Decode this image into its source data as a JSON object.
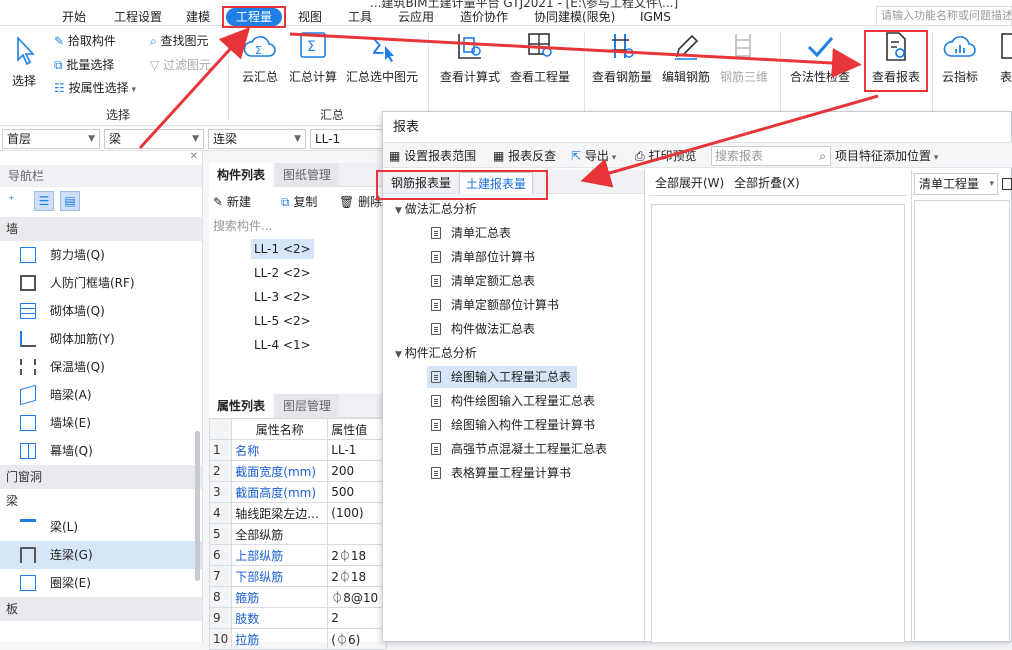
{
  "title_bar": {
    "text": "...建筑BIM土建计量平台 GTJ2021 - [E:\\参与工程文件\\...]"
  },
  "menu": {
    "tabs": [
      "开始",
      "工程设置",
      "建模",
      "工程量",
      "视图",
      "工具",
      "云应用",
      "造价协作",
      "协同建模(限免)",
      "IGMS"
    ],
    "active_tab": "工程量",
    "search_placeholder": "请输入功能名称或问题描述"
  },
  "ribbon": {
    "select_group": {
      "label": "选择",
      "select_btn": "选择",
      "pick": "拾取构件",
      "batch": "批量选择",
      "by_attr": "按属性选择"
    },
    "find_group": {
      "find": "查找图元",
      "filter": "过滤图元"
    },
    "summary_group": {
      "label": "汇总",
      "cloud": "云汇总",
      "calc": "汇总计算",
      "sel_calc": "汇总选中图元"
    },
    "buttons": [
      "查看计算式",
      "查看工程量",
      "查看钢筋量",
      "编辑钢筋",
      "钢筋三维",
      "合法性检查",
      "查看报表",
      "云指标",
      "表"
    ]
  },
  "selectors": {
    "floor": "首层",
    "type": "梁",
    "subtype": "连梁",
    "item": "LL-1"
  },
  "nav": {
    "header": "导航栏",
    "categories": {
      "wall": "墙",
      "door": "门窗洞",
      "beam": "梁",
      "slab": "板"
    },
    "wall_items": [
      "剪力墙(Q)",
      "人防门框墙(RF)",
      "砌体墙(Q)",
      "砌体加筋(Y)",
      "保温墙(Q)",
      "暗梁(A)",
      "墙垛(E)",
      "幕墙(Q)"
    ],
    "beam_items": [
      "梁(L)",
      "连梁(G)",
      "圈梁(E)"
    ],
    "selected_item": "连梁(G)"
  },
  "component_list": {
    "tab_on": "构件列表",
    "tab_off": "图纸管理",
    "new": "新建",
    "copy": "复制",
    "delete": "删除",
    "search_placeholder": "搜索构件...",
    "items": [
      "LL-1 <2>",
      "LL-2 <2>",
      "LL-3 <2>",
      "LL-5 <2>",
      "LL-4 <1>"
    ]
  },
  "props": {
    "tab_on": "属性列表",
    "tab_off": "图层管理",
    "head_name": "属性名称",
    "head_value": "属性值",
    "rows": [
      {
        "n": "1",
        "name": "名称",
        "value": "LL-1"
      },
      {
        "n": "2",
        "name": "截面宽度(mm)",
        "value": "200"
      },
      {
        "n": "3",
        "name": "截面高度(mm)",
        "value": "500"
      },
      {
        "n": "4",
        "name": "轴线距梁左边...",
        "value": "(100)"
      },
      {
        "n": "5",
        "name": "全部纵筋",
        "value": ""
      },
      {
        "n": "6",
        "name": "上部纵筋",
        "value": "2⏀18"
      },
      {
        "n": "7",
        "name": "下部纵筋",
        "value": "2⏀18"
      },
      {
        "n": "8",
        "name": "箍筋",
        "value": "⏀8@10"
      },
      {
        "n": "9",
        "name": "肢数",
        "value": "2"
      },
      {
        "n": "10",
        "name": "拉筋",
        "value": "(⏀6)"
      }
    ]
  },
  "dialog": {
    "title": "报表",
    "toolbar": {
      "range": "设置报表范围",
      "check": "报表反查",
      "export": "导出",
      "print": "打印预览",
      "search_placeholder": "搜索报表",
      "feature": "项目特征添加位置"
    },
    "tabs": {
      "steel": "钢筋报表量",
      "civil": "土建报表量"
    },
    "groups": [
      "做法汇总分析",
      "构件汇总分析"
    ],
    "group1_items": [
      "清单汇总表",
      "清单部位计算书",
      "清单定额汇总表",
      "清单定额部位计算书",
      "构件做法汇总表"
    ],
    "group2_items": [
      "绘图输入工程量汇总表",
      "构件绘图输入工程量汇总表",
      "绘图输入构件工程量计算书",
      "高强节点混凝土工程量汇总表",
      "表格算量工程量计算书"
    ],
    "selected_report": "绘图输入工程量汇总表",
    "expand_all": "全部展开(W)",
    "collapse_all": "全部折叠(X)",
    "right_select": "清单工程量"
  },
  "colors": {
    "accent": "#1f7fe5",
    "highlight": "#e8353a",
    "selection": "#d6e6f8"
  }
}
